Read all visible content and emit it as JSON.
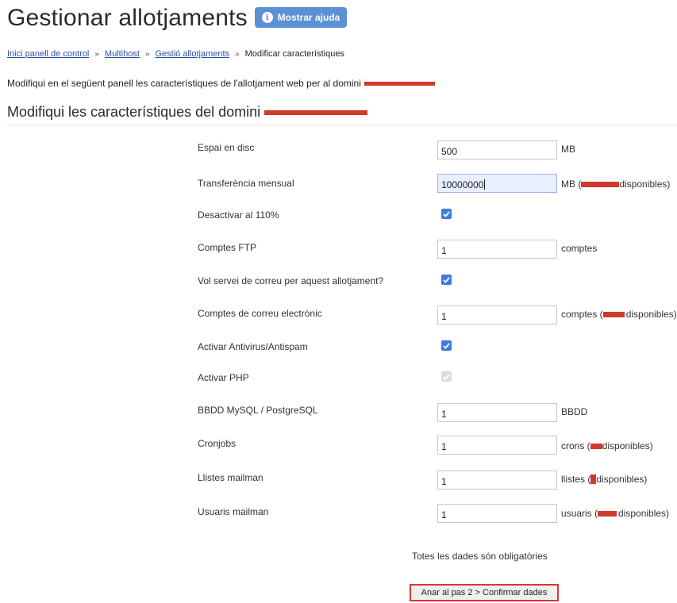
{
  "header": {
    "title": "Gestionar allotjaments",
    "help_button": "Mostrar ajuda",
    "help_icon": "info-icon"
  },
  "breadcrumb": {
    "items": [
      "Inici panell de control",
      "Multihost",
      "Gestió allotjaments"
    ],
    "current": "Modificar característiques",
    "separator": "»"
  },
  "intro_text": "Modifiqui en el següent panell les característiques de l'allotjament web per al domini",
  "section_title": "Modifiqui les característiques del domini",
  "colors": {
    "accent": "#5b8fd6",
    "checkbox": "#3b7de0",
    "redaction": "#d03a2a",
    "highlight_border": "#d43b2b"
  },
  "fields": {
    "disk": {
      "label": "Espai en disc",
      "value": "500",
      "unit": "MB"
    },
    "transfer": {
      "label": "Transferència mensual",
      "value": "10000000",
      "unit_prefix": "MB (",
      "unit_suffix": "disponibles)"
    },
    "deactivate": {
      "label": "Desactivar al 110%",
      "checked": true
    },
    "ftp": {
      "label": "Comptes FTP",
      "value": "1",
      "unit": "comptes"
    },
    "mail_service": {
      "label": "Vol servei de correu per aquest allotjament?",
      "checked": true
    },
    "mail_accounts": {
      "label": "Comptes de correu electrònic",
      "value": "1",
      "unit_prefix": "comptes (",
      "unit_suffix": "disponibles)"
    },
    "antivirus": {
      "label": "Activar Antivirus/Antispam",
      "checked": true
    },
    "php": {
      "label": "Activar PHP",
      "checked": true,
      "disabled": true
    },
    "db": {
      "label": "BBDD MySQL / PostgreSQL",
      "value": "1",
      "unit": "BBDD"
    },
    "cron": {
      "label": "Cronjobs",
      "value": "1",
      "unit_prefix": "crons (",
      "unit_suffix": "disponibles)"
    },
    "lists": {
      "label": "Llistes mailman",
      "value": "1",
      "unit_prefix": "llistes (",
      "unit_suffix": "disponibles)"
    },
    "users": {
      "label": "Usuaris mailman",
      "value": "1",
      "unit_prefix": "usuaris (",
      "unit_suffix": "disponibles)"
    }
  },
  "required_note": "Totes les dades són obligatòries",
  "submit_button": "Anar al pas 2 > Confirmar dades"
}
